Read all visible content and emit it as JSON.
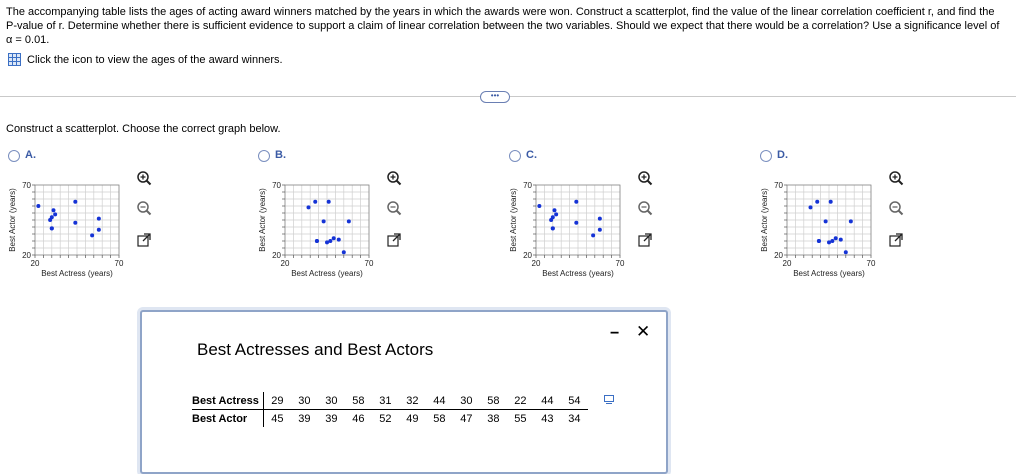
{
  "question": {
    "text": "The accompanying table lists the ages of acting award winners matched by the years in which the awards were won. Construct a scatterplot, find the value of the linear correlation coefficient r, and find the P-value of r. Determine whether there is sufficient evidence to support a claim of linear correlation between the two variables. Should we expect that there would be a correlation? Use a significance level of α = 0.01."
  },
  "help": {
    "text": "Click the icon to view the ages of the award winners."
  },
  "instruction": "Construct a scatterplot. Choose the correct graph below.",
  "options": [
    {
      "label": "A.",
      "points": [
        [
          29,
          45
        ],
        [
          30,
          39
        ],
        [
          30,
          39
        ],
        [
          58,
          46
        ],
        [
          31,
          52
        ],
        [
          32,
          49
        ],
        [
          44,
          58
        ],
        [
          30,
          47
        ],
        [
          58,
          38
        ],
        [
          22,
          55
        ],
        [
          44,
          43
        ],
        [
          54,
          34
        ]
      ]
    },
    {
      "label": "B.",
      "points": [
        [
          45,
          29
        ],
        [
          39,
          30
        ],
        [
          39,
          30
        ],
        [
          46,
          58
        ],
        [
          52,
          31
        ],
        [
          49,
          32
        ],
        [
          58,
          44
        ],
        [
          47,
          30
        ],
        [
          38,
          58
        ],
        [
          55,
          22
        ],
        [
          43,
          44
        ],
        [
          34,
          54
        ]
      ]
    },
    {
      "label": "C.",
      "points": [
        [
          29,
          45
        ],
        [
          30,
          39
        ],
        [
          30,
          39
        ],
        [
          58,
          46
        ],
        [
          31,
          52
        ],
        [
          32,
          49
        ],
        [
          44,
          58
        ],
        [
          30,
          47
        ],
        [
          58,
          38
        ],
        [
          22,
          55
        ],
        [
          44,
          43
        ],
        [
          54,
          34
        ]
      ]
    },
    {
      "label": "D.",
      "points": [
        [
          45,
          29
        ],
        [
          39,
          30
        ],
        [
          39,
          30
        ],
        [
          46,
          58
        ],
        [
          52,
          31
        ],
        [
          49,
          32
        ],
        [
          58,
          44
        ],
        [
          47,
          30
        ],
        [
          38,
          58
        ],
        [
          55,
          22
        ],
        [
          43,
          44
        ],
        [
          34,
          54
        ]
      ]
    }
  ],
  "axis": {
    "xlabel": "Best Actress (years)",
    "ylabel": "Best Actor (years)",
    "min_label": "20",
    "max_label": "70",
    "min": 20,
    "max": 70
  },
  "more_button": "•••",
  "modal": {
    "title": "Best Actresses and Best Actors",
    "row1_label": "Best Actress",
    "row1": [
      29,
      30,
      30,
      58,
      31,
      32,
      44,
      30,
      58,
      22,
      44,
      54
    ],
    "row2_label": "Best Actor",
    "row2": [
      45,
      39,
      39,
      46,
      52,
      49,
      58,
      47,
      38,
      55,
      43,
      34
    ],
    "minimize": "−",
    "close": "✕"
  },
  "colors": {
    "accent": "#3b5ba5",
    "point": "#1533d6"
  }
}
